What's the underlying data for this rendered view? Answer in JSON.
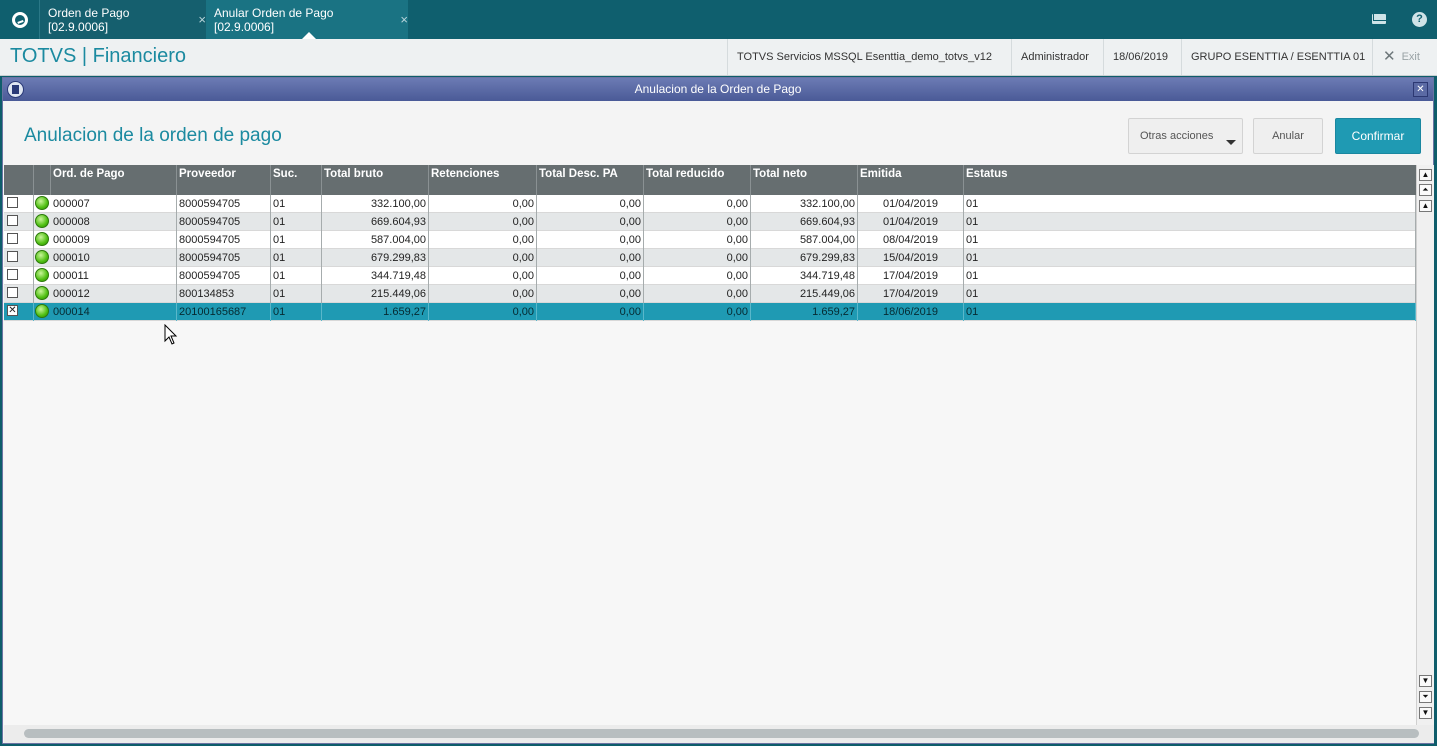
{
  "tabs": [
    {
      "label": "Orden de Pago [02.9.0006]",
      "close": "×"
    },
    {
      "label": "Anular Orden de Pago [02.9.0006]",
      "close": "×"
    }
  ],
  "header": {
    "brand": "TOTVS | Financiero",
    "environment": "TOTVS Servicios MSSQL Esenttia_demo_totvs_v12",
    "user": "Administrador",
    "date": "18/06/2019",
    "company": "GRUPO ESENTTIA / ESENTTIA 01",
    "exit_label": "Exit"
  },
  "dialog": {
    "title": "Anulacion de la Orden de Pago",
    "heading": "Anulacion de la orden de pago",
    "buttons": {
      "otras": "Otras acciones",
      "anular": "Anular",
      "confirmar": "Confirmar"
    }
  },
  "table": {
    "columns": [
      "Ord. de Pago",
      "Proveedor",
      "Suc.",
      "Total bruto",
      "Retenciones",
      "Total Desc. PA",
      "Total reducido",
      "Total neto",
      "Emitida",
      "Estatus"
    ],
    "rows": [
      {
        "checked": false,
        "orden": "000007",
        "proveedor": "8000594705",
        "suc": "01",
        "bruto": "332.100,00",
        "ret": "0,00",
        "desc": "0,00",
        "red": "0,00",
        "neto": "332.100,00",
        "emitida": "01/04/2019",
        "estatus": "01"
      },
      {
        "checked": false,
        "orden": "000008",
        "proveedor": "8000594705",
        "suc": "01",
        "bruto": "669.604,93",
        "ret": "0,00",
        "desc": "0,00",
        "red": "0,00",
        "neto": "669.604,93",
        "emitida": "01/04/2019",
        "estatus": "01"
      },
      {
        "checked": false,
        "orden": "000009",
        "proveedor": "8000594705",
        "suc": "01",
        "bruto": "587.004,00",
        "ret": "0,00",
        "desc": "0,00",
        "red": "0,00",
        "neto": "587.004,00",
        "emitida": "08/04/2019",
        "estatus": "01"
      },
      {
        "checked": false,
        "orden": "000010",
        "proveedor": "8000594705",
        "suc": "01",
        "bruto": "679.299,83",
        "ret": "0,00",
        "desc": "0,00",
        "red": "0,00",
        "neto": "679.299,83",
        "emitida": "15/04/2019",
        "estatus": "01"
      },
      {
        "checked": false,
        "orden": "000011",
        "proveedor": "8000594705",
        "suc": "01",
        "bruto": "344.719,48",
        "ret": "0,00",
        "desc": "0,00",
        "red": "0,00",
        "neto": "344.719,48",
        "emitida": "17/04/2019",
        "estatus": "01"
      },
      {
        "checked": false,
        "orden": "000012",
        "proveedor": "800134853",
        "suc": "01",
        "bruto": "215.449,06",
        "ret": "0,00",
        "desc": "0,00",
        "red": "0,00",
        "neto": "215.449,06",
        "emitida": "17/04/2019",
        "estatus": "01"
      },
      {
        "checked": true,
        "orden": "000014",
        "proveedor": "20100165687",
        "suc": "01",
        "bruto": "1.659,27",
        "ret": "0,00",
        "desc": "0,00",
        "red": "0,00",
        "neto": "1.659,27",
        "emitida": "18/06/2019",
        "estatus": "01"
      }
    ],
    "selected_row": 6
  },
  "icons": {
    "home": "totvs-home-icon",
    "mail": "mail-icon",
    "help": "help-icon",
    "exit": "close-icon",
    "status": "green-status-led-icon",
    "dialog": "app-window-icon"
  },
  "colors": {
    "tabbar": "#0f5f6e",
    "accent": "#1f9ab3",
    "grid_header": "#666e70",
    "dialog_title": "#4a5a97"
  }
}
